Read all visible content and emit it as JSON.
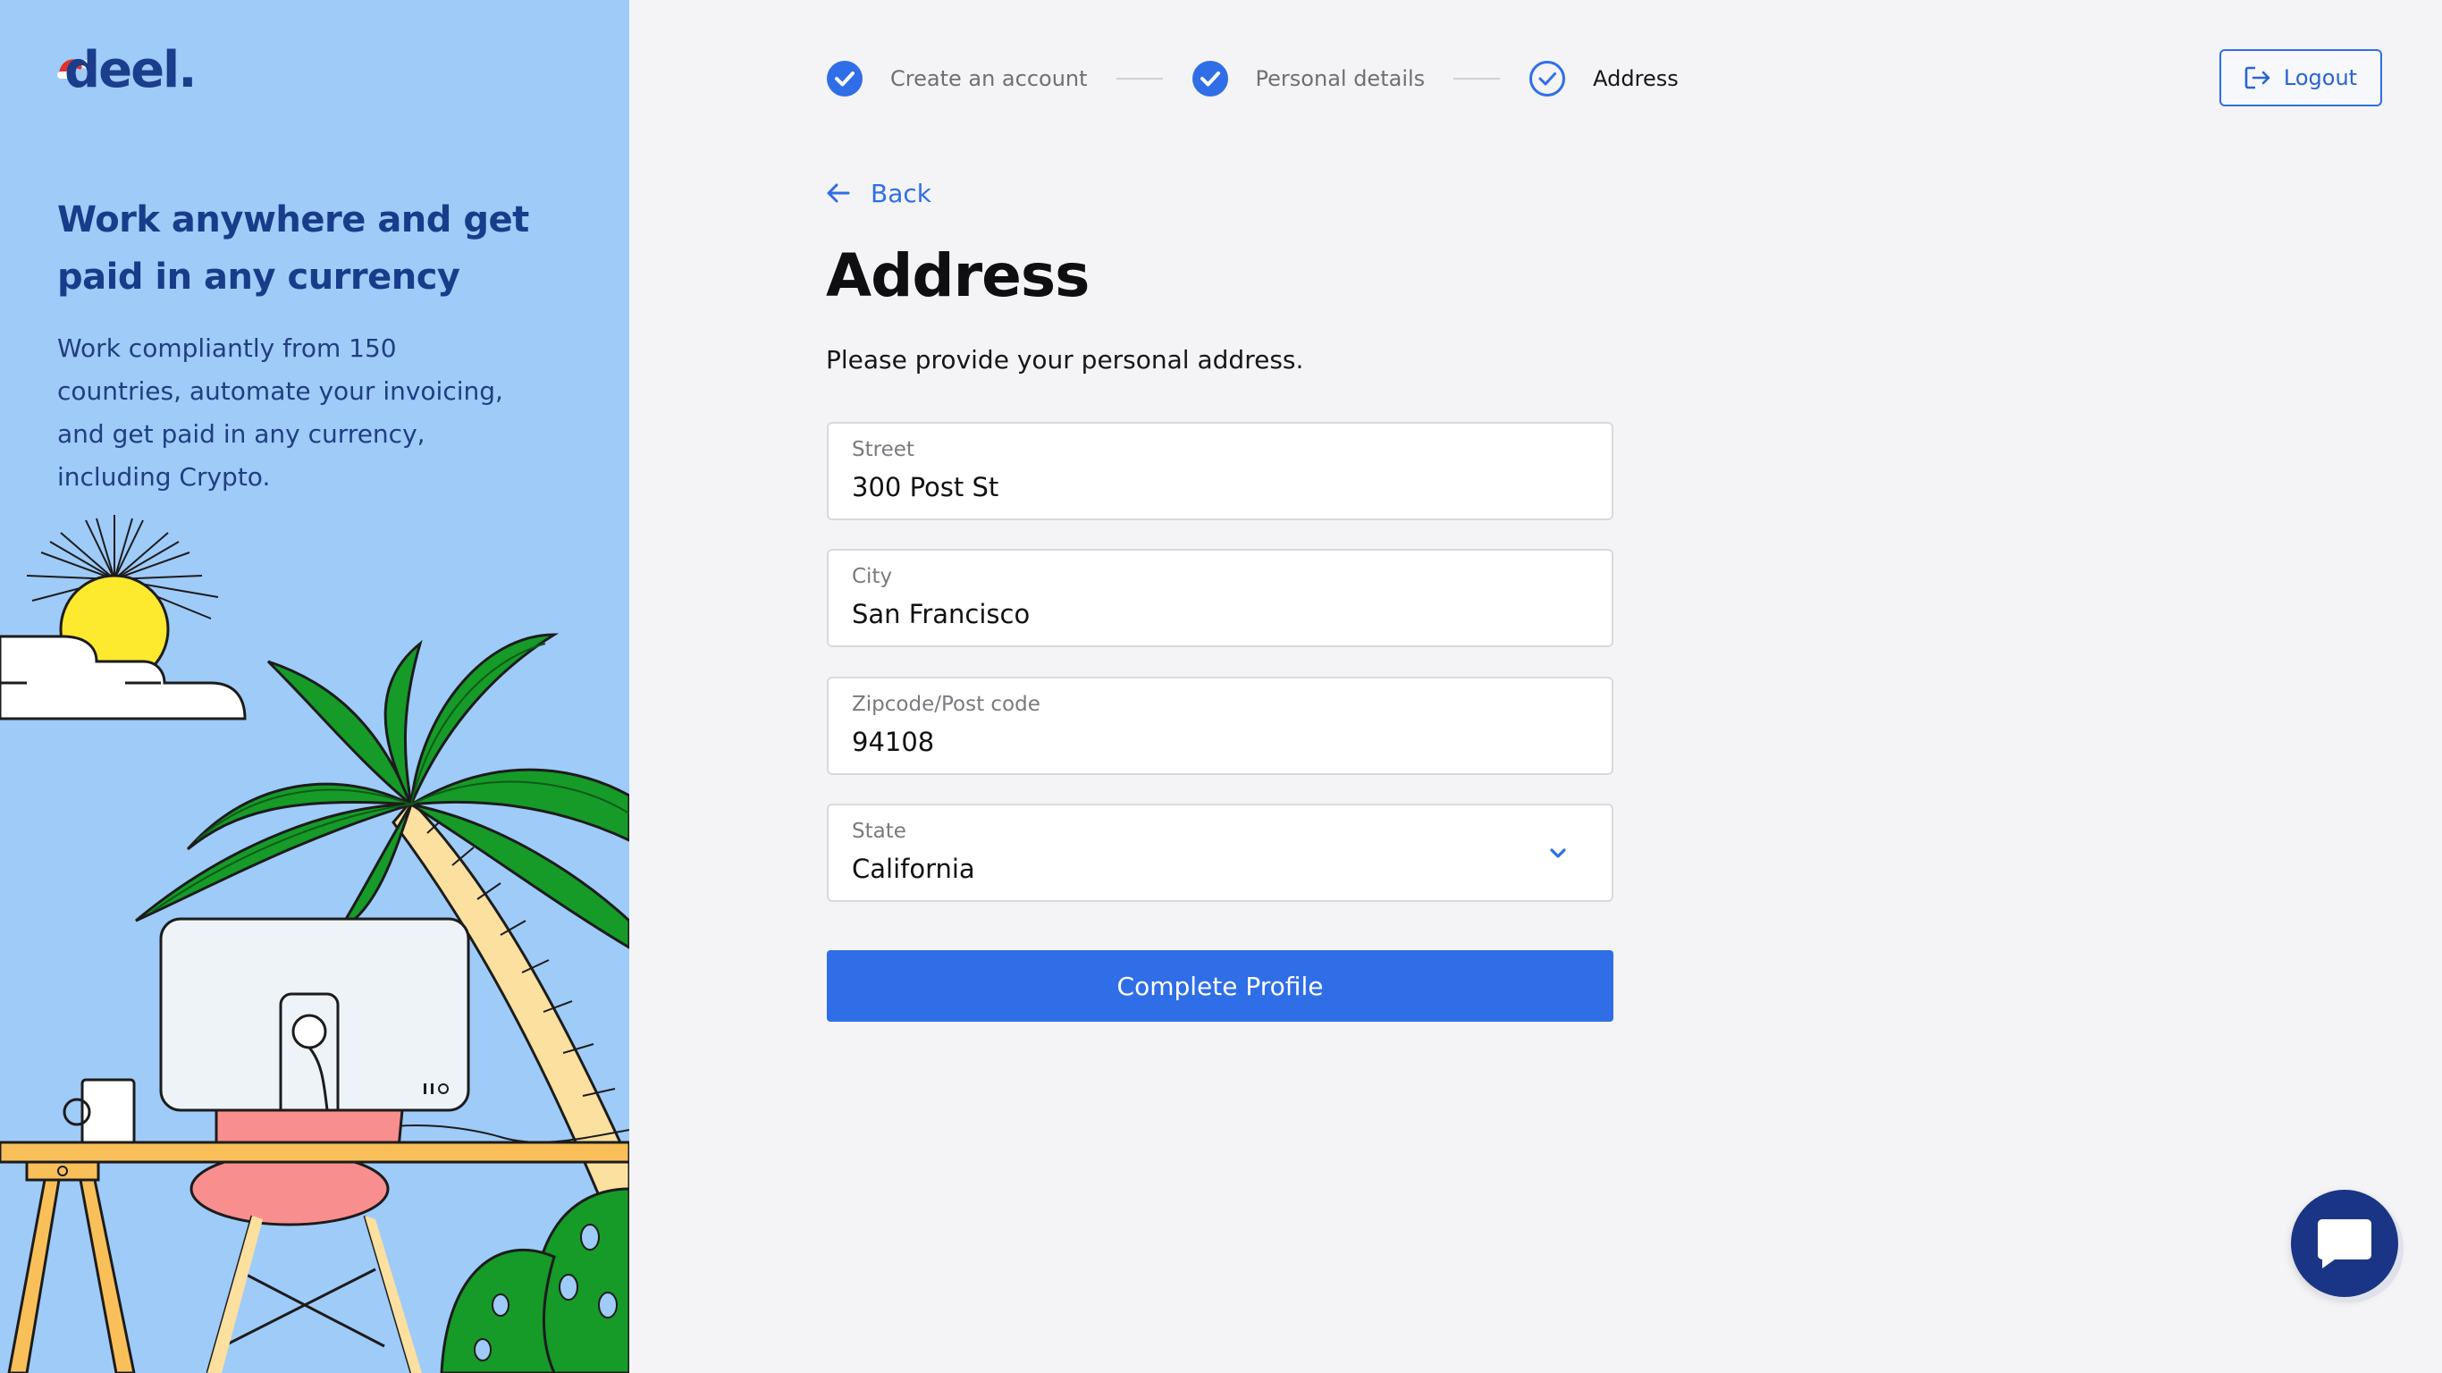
{
  "brand": {
    "logo_text": "deel."
  },
  "left_panel": {
    "headline": "Work anywhere and get paid in any currency",
    "subtext": "Work compliantly from 150 countries, automate your invoicing, and get paid in any currency, including Crypto."
  },
  "stepper": {
    "steps": [
      {
        "label": "Create an account",
        "state": "completed"
      },
      {
        "label": "Personal details",
        "state": "completed"
      },
      {
        "label": "Address",
        "state": "current"
      }
    ]
  },
  "header": {
    "logout_label": "Logout"
  },
  "form": {
    "back_label": "Back",
    "title": "Address",
    "description": "Please provide your personal address.",
    "street": {
      "label": "Street",
      "value": "300 Post St"
    },
    "city": {
      "label": "City",
      "value": "San Francisco"
    },
    "zipcode": {
      "label": "Zipcode/Post code",
      "value": "94108"
    },
    "state": {
      "label": "State",
      "value": "California"
    },
    "submit_label": "Complete Profile"
  },
  "colors": {
    "accent": "#2f6ee6",
    "brand_navy": "#1a3e8c",
    "left_panel_bg": "#9fcbf9",
    "page_bg": "#f4f4f6"
  },
  "icons": [
    "check-circle-icon",
    "check-circle-outline-icon",
    "logout-icon",
    "arrow-left-icon",
    "chevron-down-icon",
    "chat-icon"
  ]
}
